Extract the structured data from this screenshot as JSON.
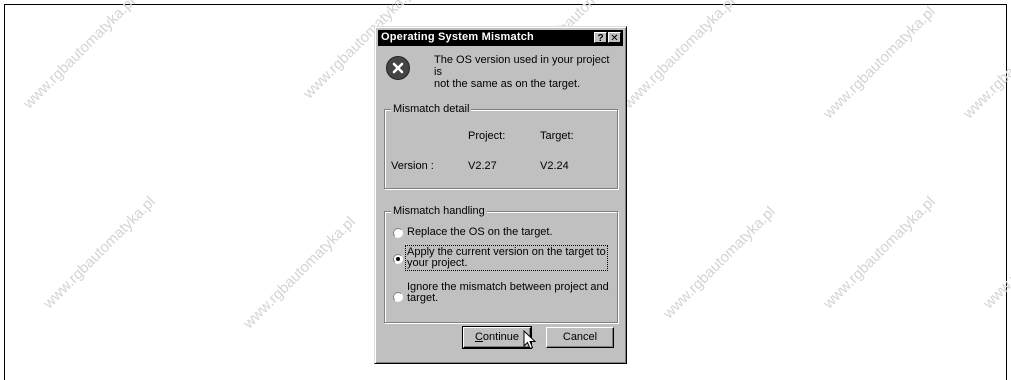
{
  "watermark": "www.rgbautomatyka.pl",
  "dialog": {
    "title": "Operating System Mismatch",
    "help_label": "?",
    "close_label": "✕",
    "icon": "error-icon",
    "message_line1": "The OS version used in your project is",
    "message_line2": "not the same as on the target.",
    "detail": {
      "legend": "Mismatch detail",
      "project_header": "Project:",
      "target_header": "Target:",
      "row_label": "Version :",
      "project_version": "V2.27",
      "target_version": "V2.24"
    },
    "handling": {
      "legend": "Mismatch handling",
      "options": [
        {
          "line1": "Replace the OS on the target.",
          "line2": "",
          "selected": false
        },
        {
          "line1": "Apply the current version on the target to",
          "line2": "your project.",
          "selected": true
        },
        {
          "line1": "Ignore the mismatch between project and",
          "line2": "target.",
          "selected": false
        }
      ]
    },
    "continue_label_first": "C",
    "continue_label_rest": "ontinue",
    "cancel_label": "Cancel"
  }
}
